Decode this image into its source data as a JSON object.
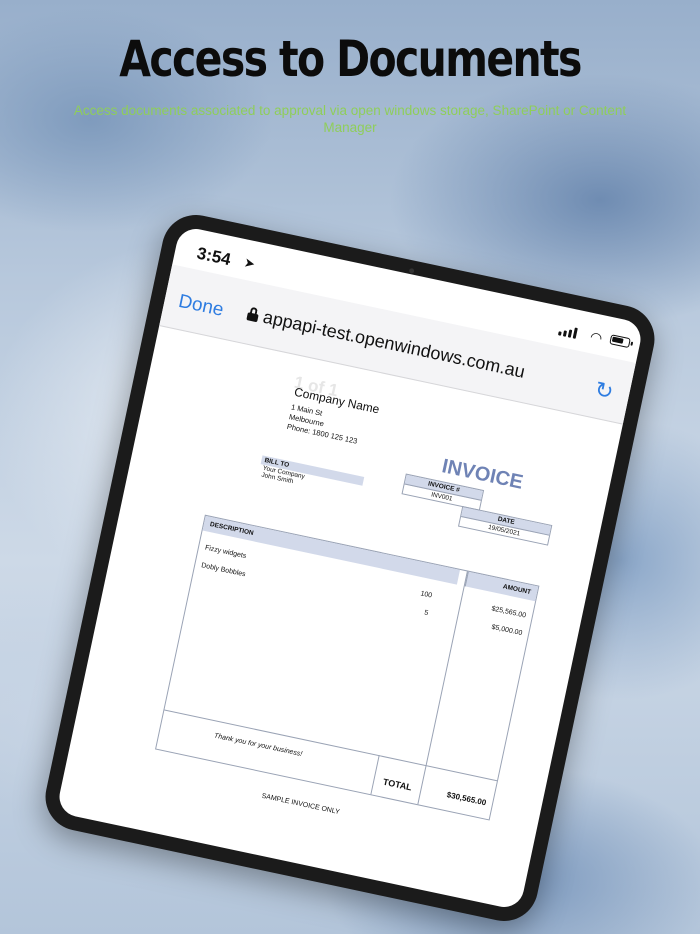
{
  "header": {
    "title": "Access to Documents",
    "subtitle": "Access documents associated to approval via open windows storage, SharePoint or Content Manager"
  },
  "device": {
    "status_time": "3:54",
    "icons": [
      "location-arrow-icon",
      "cellular-signal-icon",
      "wifi-icon",
      "battery-icon"
    ]
  },
  "browser": {
    "done_label": "Done",
    "url": "appapi-test.openwindows.com.au",
    "accent_color": "#2f7de1"
  },
  "invoice": {
    "page_counter": "1 of 1",
    "company_name": "Company Name",
    "address_line1": "1 Main St",
    "address_line2": "Melbourne",
    "phone": "Phone: 1800 125 123",
    "title": "INVOICE",
    "invoice_no_header": "INVOICE #",
    "invoice_no": "INV001",
    "date_header": "DATE",
    "date": "19/05/2021",
    "bill_to_header": "BILL TO",
    "bill_to_line1": "Your Company",
    "bill_to_line2": "John Smith",
    "description_header": "DESCRIPTION",
    "amount_header": "AMOUNT",
    "items": [
      {
        "description": "Fizzy widgets",
        "qty": "100",
        "amount": "$25,565.00"
      },
      {
        "description": "Dobly Bobbles",
        "qty": "5",
        "amount": "$5,000.00"
      }
    ],
    "thanks": "Thank you for your business!",
    "total_label": "TOTAL",
    "total_value": "$30,565.00",
    "footer_note": "SAMPLE INVOICE ONLY",
    "accent_color": "#6f83b5"
  }
}
